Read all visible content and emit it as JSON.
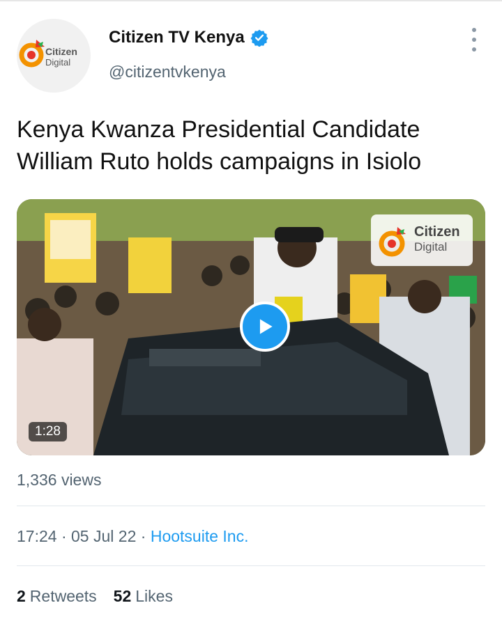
{
  "author": {
    "display_name": "Citizen TV Kenya",
    "handle": "@citizentvkenya",
    "avatar_text_line1": "Citizen",
    "avatar_text_line2": "Digital",
    "verified": true
  },
  "tweet": {
    "text": "Kenya Kwanza Presidential Candidate William Ruto holds campaigns in Isiolo"
  },
  "media": {
    "duration": "1:28",
    "watermark_line1": "Citizen",
    "watermark_line2": "Digital",
    "play_icon": "play-icon"
  },
  "views": "1,336 views",
  "meta": {
    "time": "17:24",
    "date": "05 Jul 22",
    "separator": " · ",
    "source": "Hootsuite Inc."
  },
  "stats": {
    "retweets_count": "2",
    "retweets_label": "Retweets",
    "likes_count": "52",
    "likes_label": "Likes"
  },
  "colors": {
    "accent": "#1d9bf0",
    "secondary_text": "#536471",
    "brand_red": "#e63329",
    "brand_orange": "#f39200",
    "brand_green": "#2bb24c"
  }
}
